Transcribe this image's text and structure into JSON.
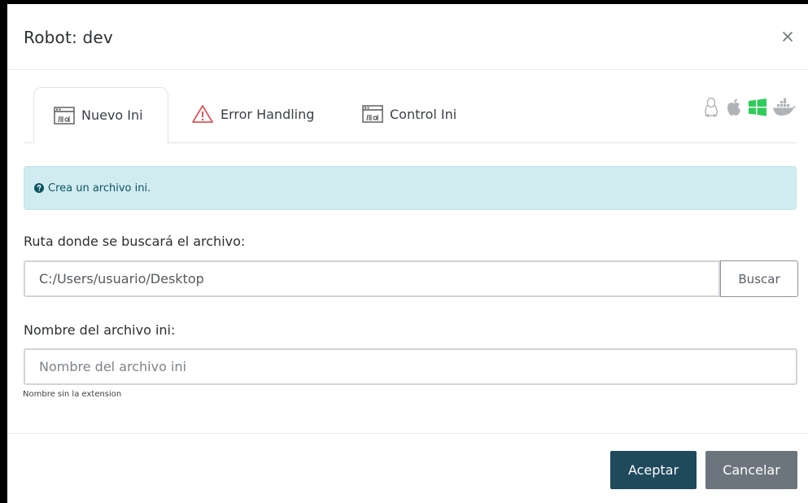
{
  "modal": {
    "title": "Robot: dev",
    "close_icon": "close-icon"
  },
  "tabs": [
    {
      "label": "Nuevo Ini",
      "icon": "ini-file-icon",
      "active": true
    },
    {
      "label": "Error Handling",
      "icon": "warning-icon",
      "active": false
    },
    {
      "label": "Control Ini",
      "icon": "ini-file-icon",
      "active": false
    }
  ],
  "os_icons": [
    "linux-icon",
    "apple-icon",
    "windows-icon",
    "docker-icon"
  ],
  "alert": {
    "icon": "question-circle-icon",
    "text": "Crea un archivo ini."
  },
  "form": {
    "path_label": "Ruta donde se buscará el archivo:",
    "path_value": "C:/Users/usuario/Desktop",
    "browse_label": "Buscar",
    "name_label": "Nombre del archivo ini:",
    "name_placeholder": "Nombre del archivo ini",
    "name_help": "Nombre sin la extension"
  },
  "footer": {
    "accept_label": "Aceptar",
    "cancel_label": "Cancelar"
  },
  "colors": {
    "accept": "#1f4a5c",
    "cancel": "#6c757d",
    "alert_bg": "#d1ecf1",
    "alert_text": "#0c5460",
    "warning": "#e0555b",
    "windows": "#2ecc5a",
    "os_gray": "#b0b3b6"
  }
}
